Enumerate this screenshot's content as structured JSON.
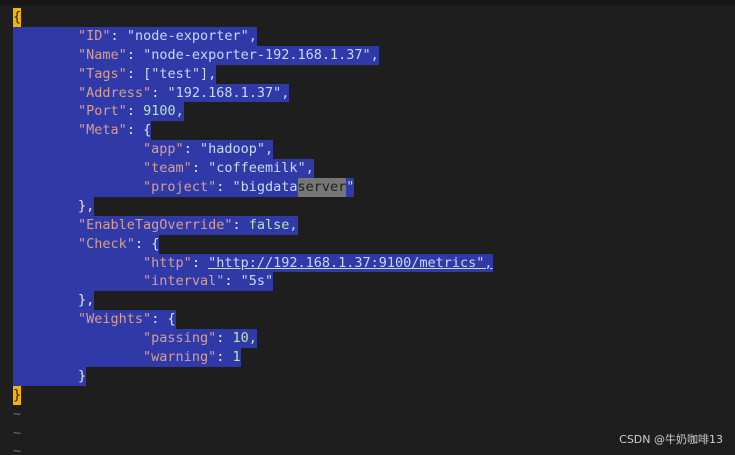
{
  "editor": {
    "lines": [
      {
        "indent": "",
        "key": "",
        "value": "{"
      },
      {
        "indent": "        ",
        "key": "\"ID\"",
        "value": "\"node-exporter\","
      },
      {
        "indent": "        ",
        "key": "\"Name\"",
        "value": "\"node-exporter-192.168.1.37\","
      },
      {
        "indent": "        ",
        "key": "\"Tags\"",
        "value": "[\"test\"],"
      },
      {
        "indent": "        ",
        "key": "\"Address\"",
        "value": "\"192.168.1.37\","
      },
      {
        "indent": "        ",
        "key": "\"Port\"",
        "value": "9100,"
      },
      {
        "indent": "        ",
        "key": "\"Meta\"",
        "value": "{"
      },
      {
        "indent": "                ",
        "key": "\"app\"",
        "value": "\"hadoop\","
      },
      {
        "indent": "                ",
        "key": "\"team\"",
        "value": "\"coffeemilk\","
      },
      {
        "indent": "                ",
        "key": "\"project\"",
        "value": "\"bigdata",
        "highlight": "server",
        "after": "\""
      },
      {
        "indent": "        ",
        "key": "",
        "value": "},"
      },
      {
        "indent": "        ",
        "key": "\"EnableTagOverride\"",
        "value": "false,"
      },
      {
        "indent": "        ",
        "key": "\"Check\"",
        "value": "{"
      },
      {
        "indent": "                ",
        "key": "\"http\"",
        "value": "\"http://192.168.1.37:9100/metrics\","
      },
      {
        "indent": "                ",
        "key": "\"interval\"",
        "value": "\"5s\""
      },
      {
        "indent": "        ",
        "key": "",
        "value": "},"
      },
      {
        "indent": "        ",
        "key": "\"Weights\"",
        "value": "{"
      },
      {
        "indent": "                ",
        "key": "\"passing\"",
        "value": "10,"
      },
      {
        "indent": "                ",
        "key": "\"warning\"",
        "value": "1"
      },
      {
        "indent": "        ",
        "key": "",
        "value": "}"
      },
      {
        "indent": "",
        "key": "",
        "value": "}"
      }
    ],
    "tilde_lines": [
      "~",
      "~",
      "~"
    ]
  },
  "watermark": "CSDN @牛奶咖啡13",
  "colors": {
    "background": "#1e1e1e",
    "selection": "#2f3aa8",
    "cursor": "#f4b400"
  }
}
